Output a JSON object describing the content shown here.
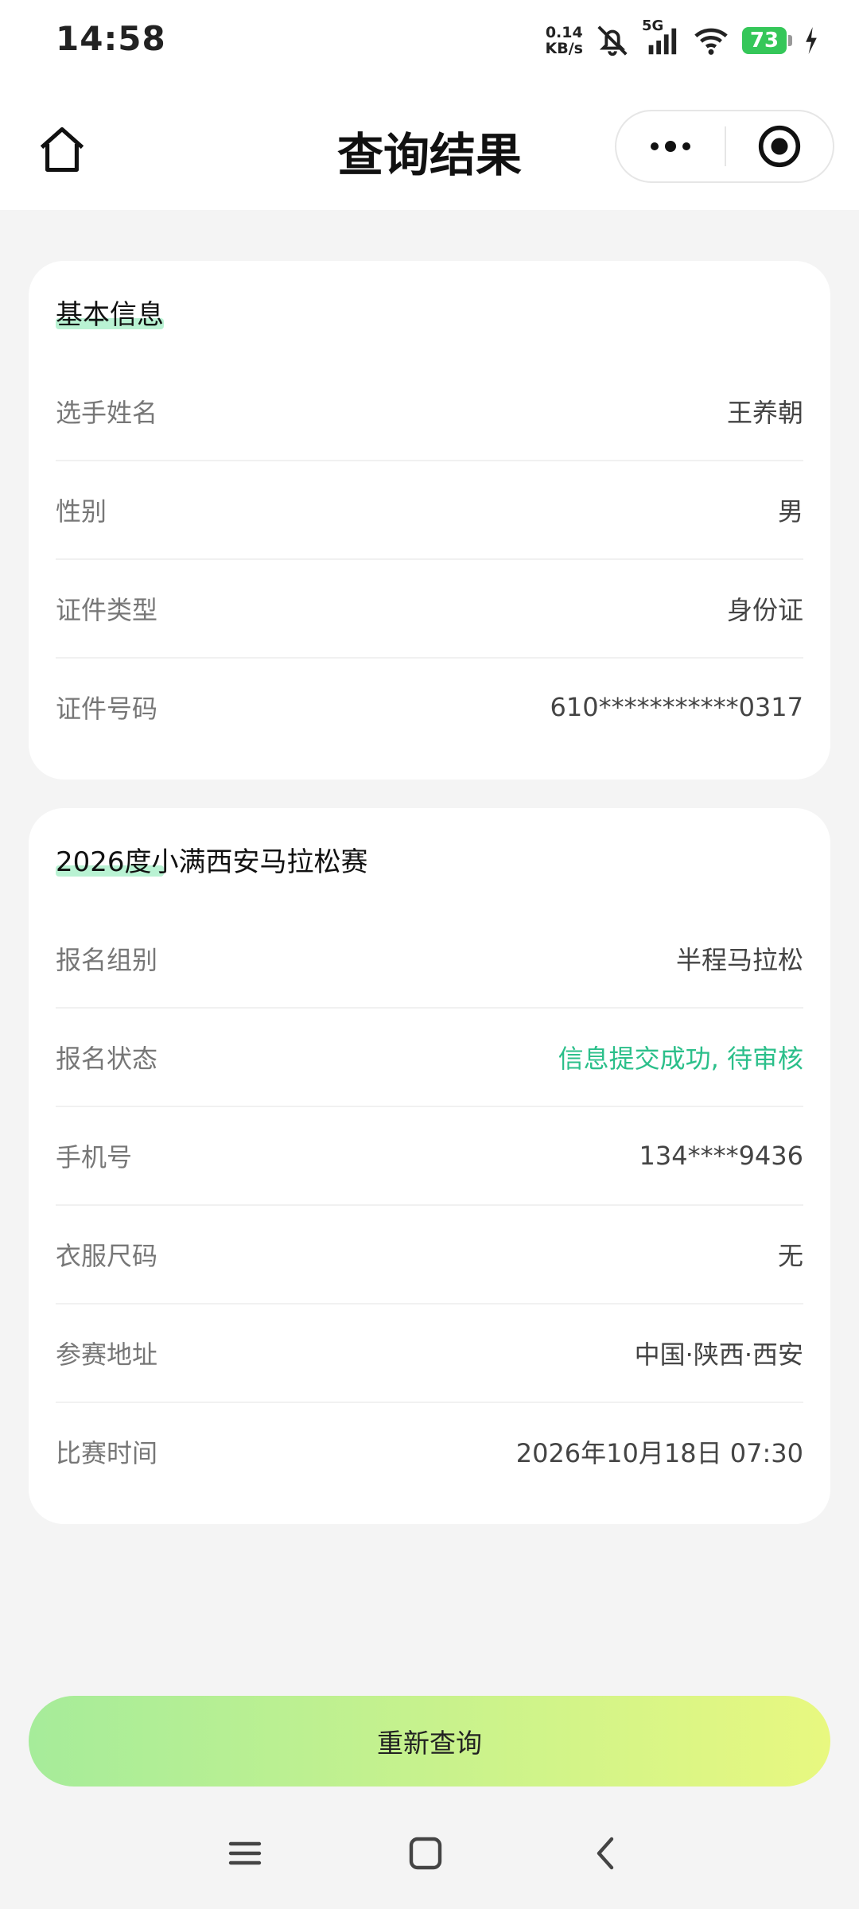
{
  "status_bar": {
    "time": "14:58",
    "net_speed_value": "0.14",
    "net_speed_unit": "KB/s",
    "network_type": "5G",
    "battery_level": "73",
    "icons": [
      "bell-mute-icon",
      "signal-icon",
      "wifi-icon",
      "battery-icon",
      "charging-icon"
    ]
  },
  "nav": {
    "title": "查询结果",
    "home_icon": "home-icon",
    "more_icon": "more-dots-icon",
    "close_icon": "target-close-icon"
  },
  "basic_info": {
    "title": "基本信息",
    "rows": [
      {
        "label": "选手姓名",
        "value": "王养朝"
      },
      {
        "label": "性别",
        "value": "男"
      },
      {
        "label": "证件类型",
        "value": "身份证"
      },
      {
        "label": "证件号码",
        "value": "610***********0317"
      }
    ]
  },
  "race_info": {
    "title": "2026度小满西安马拉松赛",
    "rows": [
      {
        "label": "报名组别",
        "value": "半程马拉松"
      },
      {
        "label": "报名状态",
        "value": "信息提交成功, 待审核"
      },
      {
        "label": "手机号",
        "value": "134****9436"
      },
      {
        "label": "衣服尺码",
        "value": "无"
      },
      {
        "label": "参赛地址",
        "value": "中国·陕西·西安"
      },
      {
        "label": "比赛时间",
        "value": "2026年10月18日 07:30"
      }
    ]
  },
  "colors": {
    "status_success": "#2bbf8a",
    "title_highlight": "#a8efc8",
    "button_gradient_start": "#a6ec9a",
    "button_gradient_end": "#e8f880",
    "battery": "#35c759"
  },
  "actions": {
    "requery_label": "重新查询"
  },
  "system_nav": {
    "icons": [
      "menu-icon",
      "home-square-icon",
      "back-icon"
    ]
  }
}
